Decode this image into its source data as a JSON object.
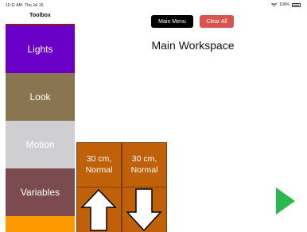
{
  "status_bar": {
    "time": "10:11 AM",
    "date": "Thu Jul 15",
    "battery": "100%",
    "icons": [
      "wifi-icon",
      "battery-icon"
    ]
  },
  "toolbox": {
    "title": "Toolbox",
    "categories": [
      {
        "label": "Lights",
        "color": "#6a00c8"
      },
      {
        "label": "Look",
        "color": "#8a7552"
      },
      {
        "label": "Motion",
        "color": "#cfcfd1"
      },
      {
        "label": "Variables",
        "color": "#7c4b4f"
      },
      {
        "label": "",
        "color": "#ff9900"
      }
    ]
  },
  "header": {
    "main_menu_label": "Main Menu",
    "clear_all_label": "Clear All",
    "main_menu_color": "#000000",
    "clear_all_color": "#d9534f"
  },
  "workspace": {
    "title": "Main Workspace",
    "blocks": [
      {
        "line1": "30 cm,",
        "line2": "Normal",
        "icon": "up-arrow-icon"
      },
      {
        "line1": "30 cm,",
        "line2": "Normal",
        "icon": "down-arrow-icon"
      }
    ],
    "block_color": "#c0610a",
    "run_icon": "play-icon",
    "run_color": "#2db84d"
  }
}
